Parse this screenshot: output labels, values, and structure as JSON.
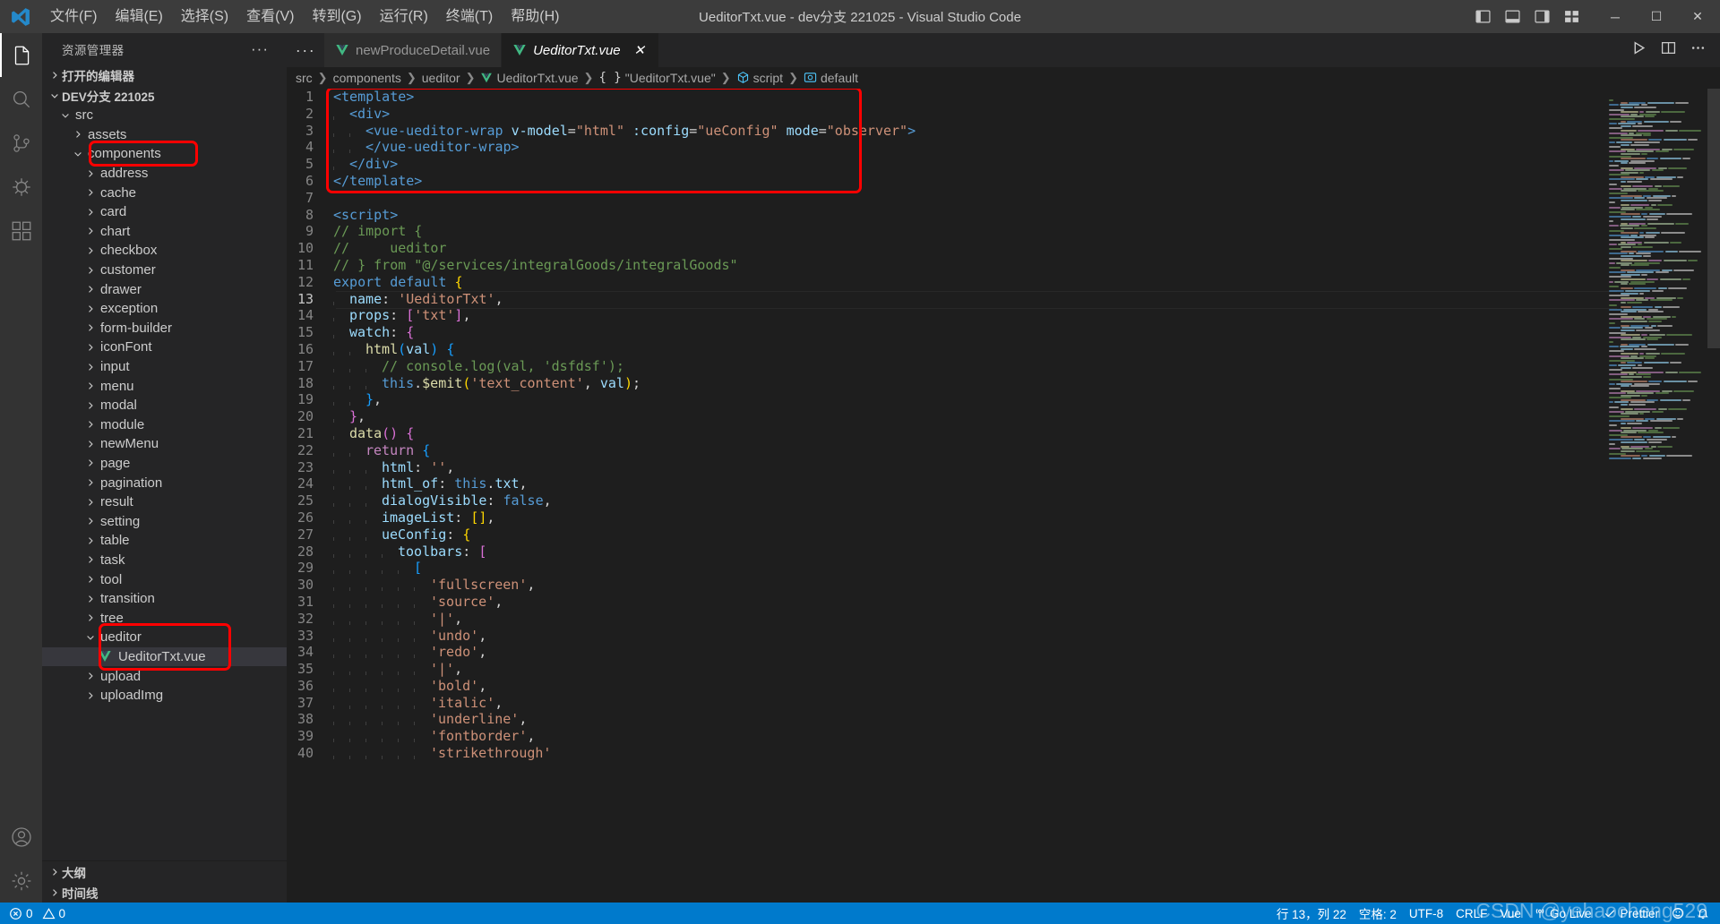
{
  "window": {
    "title": "UeditorTxt.vue - dev分支 221025 - Visual Studio Code",
    "menus": [
      "文件(F)",
      "编辑(E)",
      "选择(S)",
      "查看(V)",
      "转到(G)",
      "运行(R)",
      "终端(T)",
      "帮助(H)"
    ],
    "controls": {
      "minimize": "─",
      "maximize": "☐",
      "close": "✕"
    }
  },
  "activitybar": {
    "items": [
      {
        "name": "explorer",
        "icon": "files-icon"
      },
      {
        "name": "search",
        "icon": "search-icon"
      },
      {
        "name": "source-control",
        "icon": "source-control-icon"
      },
      {
        "name": "run-and-debug",
        "icon": "debug-icon"
      },
      {
        "name": "extensions",
        "icon": "extensions-icon"
      }
    ],
    "bottom": [
      {
        "name": "accounts",
        "icon": "account-icon"
      },
      {
        "name": "settings",
        "icon": "gear-icon"
      }
    ]
  },
  "sidebar": {
    "title": "资源管理器",
    "actions": "···",
    "sections": [
      {
        "label": "打开的编辑器",
        "expanded": false
      },
      {
        "label": "DEV分支 221025",
        "expanded": true
      }
    ],
    "tree": [
      {
        "label": "src",
        "indent": 1,
        "type": "folder",
        "expanded": true
      },
      {
        "label": "assets",
        "indent": 2,
        "type": "folder",
        "expanded": false
      },
      {
        "label": "components",
        "indent": 2,
        "type": "folder",
        "expanded": true,
        "highlight": true
      },
      {
        "label": "address",
        "indent": 3,
        "type": "folder",
        "expanded": false
      },
      {
        "label": "cache",
        "indent": 3,
        "type": "folder",
        "expanded": false
      },
      {
        "label": "card",
        "indent": 3,
        "type": "folder",
        "expanded": false
      },
      {
        "label": "chart",
        "indent": 3,
        "type": "folder",
        "expanded": false
      },
      {
        "label": "checkbox",
        "indent": 3,
        "type": "folder",
        "expanded": false
      },
      {
        "label": "customer",
        "indent": 3,
        "type": "folder",
        "expanded": false
      },
      {
        "label": "drawer",
        "indent": 3,
        "type": "folder",
        "expanded": false
      },
      {
        "label": "exception",
        "indent": 3,
        "type": "folder",
        "expanded": false
      },
      {
        "label": "form-builder",
        "indent": 3,
        "type": "folder",
        "expanded": false
      },
      {
        "label": "iconFont",
        "indent": 3,
        "type": "folder",
        "expanded": false
      },
      {
        "label": "input",
        "indent": 3,
        "type": "folder",
        "expanded": false
      },
      {
        "label": "menu",
        "indent": 3,
        "type": "folder",
        "expanded": false
      },
      {
        "label": "modal",
        "indent": 3,
        "type": "folder",
        "expanded": false
      },
      {
        "label": "module",
        "indent": 3,
        "type": "folder",
        "expanded": false
      },
      {
        "label": "newMenu",
        "indent": 3,
        "type": "folder",
        "expanded": false
      },
      {
        "label": "page",
        "indent": 3,
        "type": "folder",
        "expanded": false
      },
      {
        "label": "pagination",
        "indent": 3,
        "type": "folder",
        "expanded": false
      },
      {
        "label": "result",
        "indent": 3,
        "type": "folder",
        "expanded": false
      },
      {
        "label": "setting",
        "indent": 3,
        "type": "folder",
        "expanded": false
      },
      {
        "label": "table",
        "indent": 3,
        "type": "folder",
        "expanded": false
      },
      {
        "label": "task",
        "indent": 3,
        "type": "folder",
        "expanded": false
      },
      {
        "label": "tool",
        "indent": 3,
        "type": "folder",
        "expanded": false
      },
      {
        "label": "transition",
        "indent": 3,
        "type": "folder",
        "expanded": false
      },
      {
        "label": "tree",
        "indent": 3,
        "type": "folder",
        "expanded": false
      },
      {
        "label": "ueditor",
        "indent": 3,
        "type": "folder",
        "expanded": true
      },
      {
        "label": "UeditorTxt.vue",
        "indent": 4,
        "type": "vue-file",
        "selected": true
      },
      {
        "label": "upload",
        "indent": 3,
        "type": "folder",
        "expanded": false
      },
      {
        "label": "uploadImg",
        "indent": 3,
        "type": "folder",
        "expanded": false
      }
    ],
    "bottom_sections": [
      {
        "label": "大纲",
        "expanded": false
      },
      {
        "label": "时间线",
        "expanded": false
      }
    ]
  },
  "editor": {
    "tabs": [
      {
        "label": "newProduceDetail.vue",
        "active": false,
        "icon": "vue-icon"
      },
      {
        "label": "UeditorTxt.vue",
        "active": true,
        "icon": "vue-icon",
        "close": "✕"
      }
    ],
    "tab_actions": [
      "run-icon",
      "split-editor-icon",
      "more-actions-icon"
    ],
    "breadcrumb": [
      {
        "text": "src",
        "icon": null
      },
      {
        "text": "components",
        "icon": null
      },
      {
        "text": "ueditor",
        "icon": null
      },
      {
        "text": "UeditorTxt.vue",
        "icon": "vue-icon"
      },
      {
        "text": "\"UeditorTxt.vue\"",
        "icon": "braces-icon"
      },
      {
        "text": "script",
        "icon": "module-icon"
      },
      {
        "text": "default",
        "icon": "property-icon"
      }
    ],
    "current_line": 13,
    "lines": [
      {
        "n": 1,
        "indent": 0,
        "tokens": [
          {
            "c": "t-tag",
            "t": "<template>"
          }
        ]
      },
      {
        "n": 2,
        "indent": 1,
        "tokens": [
          {
            "c": "t-tag",
            "t": "<div>"
          }
        ]
      },
      {
        "n": 3,
        "indent": 2,
        "tokens": [
          {
            "c": "t-tag",
            "t": "<vue-ueditor-wrap "
          },
          {
            "c": "t-attr",
            "t": "v-model"
          },
          {
            "c": "t-eq",
            "t": "="
          },
          {
            "c": "t-str",
            "t": "\"html\""
          },
          {
            "c": "t-plain",
            "t": " "
          },
          {
            "c": "t-attr",
            "t": ":config"
          },
          {
            "c": "t-eq",
            "t": "="
          },
          {
            "c": "t-str",
            "t": "\"ueConfig\""
          },
          {
            "c": "t-plain",
            "t": " "
          },
          {
            "c": "t-attr",
            "t": "mode"
          },
          {
            "c": "t-eq",
            "t": "="
          },
          {
            "c": "t-str",
            "t": "\"observer\""
          },
          {
            "c": "t-tag",
            "t": ">"
          }
        ]
      },
      {
        "n": 4,
        "indent": 2,
        "tokens": [
          {
            "c": "t-tag",
            "t": "</vue-ueditor-wrap>"
          }
        ]
      },
      {
        "n": 5,
        "indent": 1,
        "tokens": [
          {
            "c": "t-tag",
            "t": "</div>"
          }
        ]
      },
      {
        "n": 6,
        "indent": 0,
        "tokens": [
          {
            "c": "t-tag",
            "t": "</template>"
          }
        ]
      },
      {
        "n": 7,
        "indent": 0,
        "tokens": []
      },
      {
        "n": 8,
        "indent": 0,
        "tokens": [
          {
            "c": "t-tag",
            "t": "<script>"
          }
        ]
      },
      {
        "n": 9,
        "indent": 0,
        "tokens": [
          {
            "c": "t-cmt",
            "t": "// import {"
          }
        ]
      },
      {
        "n": 10,
        "indent": 0,
        "tokens": [
          {
            "c": "t-cmt",
            "t": "//     ueditor"
          }
        ]
      },
      {
        "n": 11,
        "indent": 0,
        "tokens": [
          {
            "c": "t-cmt",
            "t": "// } from \"@/services/integralGoods/integralGoods\""
          }
        ]
      },
      {
        "n": 12,
        "indent": 0,
        "tokens": [
          {
            "c": "t-kw",
            "t": "export default "
          },
          {
            "c": "t-p1",
            "t": "{"
          }
        ]
      },
      {
        "n": 13,
        "indent": 1,
        "tokens": [
          {
            "c": "t-prop",
            "t": "name"
          },
          {
            "c": "t-plain",
            "t": ": "
          },
          {
            "c": "t-str",
            "t": "'UeditorTxt'"
          },
          {
            "c": "t-plain",
            "t": ","
          }
        ]
      },
      {
        "n": 14,
        "indent": 1,
        "tokens": [
          {
            "c": "t-prop",
            "t": "props"
          },
          {
            "c": "t-plain",
            "t": ": "
          },
          {
            "c": "t-p2",
            "t": "["
          },
          {
            "c": "t-str",
            "t": "'txt'"
          },
          {
            "c": "t-p2",
            "t": "]"
          },
          {
            "c": "t-plain",
            "t": ","
          }
        ]
      },
      {
        "n": 15,
        "indent": 1,
        "tokens": [
          {
            "c": "t-prop",
            "t": "watch"
          },
          {
            "c": "t-plain",
            "t": ": "
          },
          {
            "c": "t-p2",
            "t": "{"
          }
        ]
      },
      {
        "n": 16,
        "indent": 2,
        "tokens": [
          {
            "c": "t-fn",
            "t": "html"
          },
          {
            "c": "t-p3",
            "t": "("
          },
          {
            "c": "t-attr",
            "t": "val"
          },
          {
            "c": "t-p3",
            "t": ")"
          },
          {
            "c": "t-plain",
            "t": " "
          },
          {
            "c": "t-p3",
            "t": "{"
          }
        ]
      },
      {
        "n": 17,
        "indent": 3,
        "tokens": [
          {
            "c": "t-cmt",
            "t": "// console.log(val, 'dsfdsf');"
          }
        ]
      },
      {
        "n": 18,
        "indent": 3,
        "tokens": [
          {
            "c": "t-this",
            "t": "this"
          },
          {
            "c": "t-plain",
            "t": "."
          },
          {
            "c": "t-fn",
            "t": "$emit"
          },
          {
            "c": "t-p1",
            "t": "("
          },
          {
            "c": "t-str",
            "t": "'text_content'"
          },
          {
            "c": "t-plain",
            "t": ", "
          },
          {
            "c": "t-attr",
            "t": "val"
          },
          {
            "c": "t-p1",
            "t": ")"
          },
          {
            "c": "t-plain",
            "t": ";"
          }
        ]
      },
      {
        "n": 19,
        "indent": 2,
        "tokens": [
          {
            "c": "t-p3",
            "t": "}"
          },
          {
            "c": "t-plain",
            "t": ","
          }
        ]
      },
      {
        "n": 20,
        "indent": 1,
        "tokens": [
          {
            "c": "t-p2",
            "t": "}"
          },
          {
            "c": "t-plain",
            "t": ","
          }
        ]
      },
      {
        "n": 21,
        "indent": 1,
        "tokens": [
          {
            "c": "t-fn",
            "t": "data"
          },
          {
            "c": "t-p2",
            "t": "()"
          },
          {
            "c": "t-plain",
            "t": " "
          },
          {
            "c": "t-p2",
            "t": "{"
          }
        ]
      },
      {
        "n": 22,
        "indent": 2,
        "tokens": [
          {
            "c": "t-kw2",
            "t": "return"
          },
          {
            "c": "t-plain",
            "t": " "
          },
          {
            "c": "t-p3",
            "t": "{"
          }
        ]
      },
      {
        "n": 23,
        "indent": 3,
        "tokens": [
          {
            "c": "t-prop",
            "t": "html"
          },
          {
            "c": "t-plain",
            "t": ": "
          },
          {
            "c": "t-str",
            "t": "''"
          },
          {
            "c": "t-plain",
            "t": ","
          }
        ]
      },
      {
        "n": 24,
        "indent": 3,
        "tokens": [
          {
            "c": "t-prop",
            "t": "html_of"
          },
          {
            "c": "t-plain",
            "t": ": "
          },
          {
            "c": "t-this",
            "t": "this"
          },
          {
            "c": "t-plain",
            "t": "."
          },
          {
            "c": "t-prop",
            "t": "txt"
          },
          {
            "c": "t-plain",
            "t": ","
          }
        ]
      },
      {
        "n": 25,
        "indent": 3,
        "tokens": [
          {
            "c": "t-prop",
            "t": "dialogVisible"
          },
          {
            "c": "t-plain",
            "t": ": "
          },
          {
            "c": "t-kw",
            "t": "false"
          },
          {
            "c": "t-plain",
            "t": ","
          }
        ]
      },
      {
        "n": 26,
        "indent": 3,
        "tokens": [
          {
            "c": "t-prop",
            "t": "imageList"
          },
          {
            "c": "t-plain",
            "t": ": "
          },
          {
            "c": "t-p1",
            "t": "[]"
          },
          {
            "c": "t-plain",
            "t": ","
          }
        ]
      },
      {
        "n": 27,
        "indent": 3,
        "tokens": [
          {
            "c": "t-prop",
            "t": "ueConfig"
          },
          {
            "c": "t-plain",
            "t": ": "
          },
          {
            "c": "t-p1",
            "t": "{"
          }
        ]
      },
      {
        "n": 28,
        "indent": 4,
        "tokens": [
          {
            "c": "t-prop",
            "t": "toolbars"
          },
          {
            "c": "t-plain",
            "t": ": "
          },
          {
            "c": "t-p2",
            "t": "["
          }
        ]
      },
      {
        "n": 29,
        "indent": 5,
        "tokens": [
          {
            "c": "t-p3",
            "t": "["
          }
        ]
      },
      {
        "n": 30,
        "indent": 6,
        "tokens": [
          {
            "c": "t-str",
            "t": "'fullscreen'"
          },
          {
            "c": "t-plain",
            "t": ","
          }
        ]
      },
      {
        "n": 31,
        "indent": 6,
        "tokens": [
          {
            "c": "t-str",
            "t": "'source'"
          },
          {
            "c": "t-plain",
            "t": ","
          }
        ]
      },
      {
        "n": 32,
        "indent": 6,
        "tokens": [
          {
            "c": "t-str",
            "t": "'|'"
          },
          {
            "c": "t-plain",
            "t": ","
          }
        ]
      },
      {
        "n": 33,
        "indent": 6,
        "tokens": [
          {
            "c": "t-str",
            "t": "'undo'"
          },
          {
            "c": "t-plain",
            "t": ","
          }
        ]
      },
      {
        "n": 34,
        "indent": 6,
        "tokens": [
          {
            "c": "t-str",
            "t": "'redo'"
          },
          {
            "c": "t-plain",
            "t": ","
          }
        ]
      },
      {
        "n": 35,
        "indent": 6,
        "tokens": [
          {
            "c": "t-str",
            "t": "'|'"
          },
          {
            "c": "t-plain",
            "t": ","
          }
        ]
      },
      {
        "n": 36,
        "indent": 6,
        "tokens": [
          {
            "c": "t-str",
            "t": "'bold'"
          },
          {
            "c": "t-plain",
            "t": ","
          }
        ]
      },
      {
        "n": 37,
        "indent": 6,
        "tokens": [
          {
            "c": "t-str",
            "t": "'italic'"
          },
          {
            "c": "t-plain",
            "t": ","
          }
        ]
      },
      {
        "n": 38,
        "indent": 6,
        "tokens": [
          {
            "c": "t-str",
            "t": "'underline'"
          },
          {
            "c": "t-plain",
            "t": ","
          }
        ]
      },
      {
        "n": 39,
        "indent": 6,
        "tokens": [
          {
            "c": "t-str",
            "t": "'fontborder'"
          },
          {
            "c": "t-plain",
            "t": ","
          }
        ]
      },
      {
        "n": 40,
        "indent": 6,
        "tokens": [
          {
            "c": "t-str",
            "t": "'strikethrough'"
          }
        ]
      }
    ]
  },
  "statusbar": {
    "left": [
      {
        "name": "problems",
        "errors": "0",
        "warnings": "0"
      }
    ],
    "right": [
      {
        "name": "cursor-position",
        "label": "行 13，列 22"
      },
      {
        "name": "indentation",
        "label": "空格: 2"
      },
      {
        "name": "encoding",
        "label": "UTF-8"
      },
      {
        "name": "eol",
        "label": "CRLF"
      },
      {
        "name": "language-mode",
        "label": "Vue"
      },
      {
        "name": "go-live",
        "label": "Go Live"
      },
      {
        "name": "prettier",
        "label": "Prettier"
      },
      {
        "name": "bell",
        "label": ""
      }
    ],
    "watermark": "CSDN @yehaocheng529"
  },
  "colors": {
    "accent": "#007acc",
    "titlebar_bg": "#3c3c3c",
    "sidebar_bg": "#252526",
    "editor_bg": "#1e1e1e",
    "activitybar_bg": "#333333",
    "highlight": "#ff0000",
    "vue_green": "#41b883"
  }
}
